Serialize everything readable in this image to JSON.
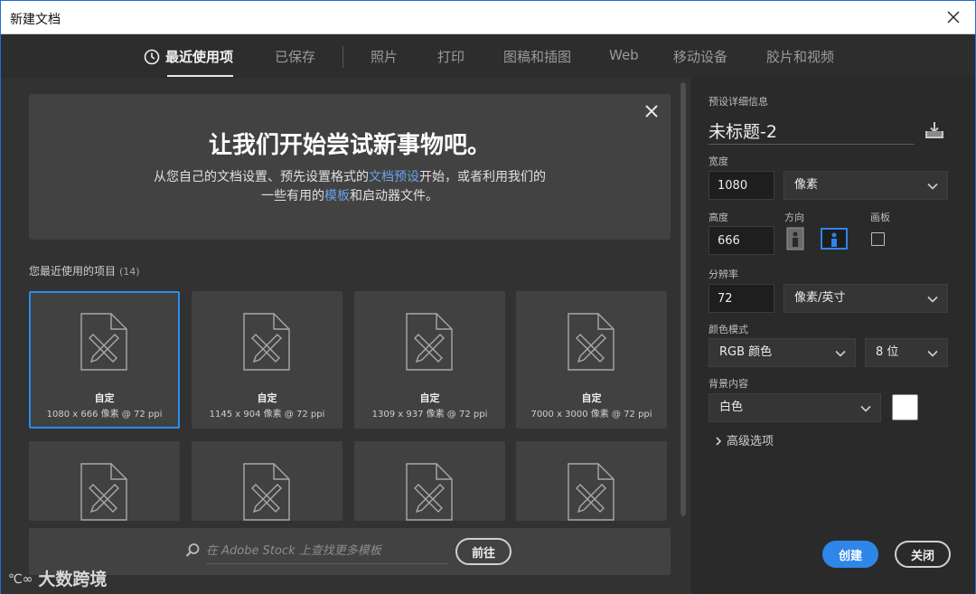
{
  "window": {
    "title": "新建文档"
  },
  "tabs": [
    {
      "label": "最近使用项",
      "active": true
    },
    {
      "label": "已保存"
    },
    {
      "label": "照片"
    },
    {
      "label": "打印"
    },
    {
      "label": "图稿和插图"
    },
    {
      "label": "Web"
    },
    {
      "label": "移动设备"
    },
    {
      "label": "胶片和视频"
    }
  ],
  "welcome": {
    "headline": "让我们开始尝试新事物吧。",
    "line1_pre": "从您自己的文档设置、预先设置格式的",
    "line1_link": "文档预设",
    "line1_post": "开始，或者利用我们的",
    "line2_pre": "一些有用的",
    "line2_link": "模板",
    "line2_post": "和启动器文件。"
  },
  "recent": {
    "label": "您最近使用的项目",
    "count": "(14)",
    "items": [
      {
        "name": "自定",
        "dims": "1080 x 666 像素 @ 72 ppi",
        "selected": true
      },
      {
        "name": "自定",
        "dims": "1145 x 904 像素 @ 72 ppi"
      },
      {
        "name": "自定",
        "dims": "1309 x 937 像素 @ 72 ppi"
      },
      {
        "name": "自定",
        "dims": "7000 x 3000 像素 @ 72 ppi"
      },
      {
        "name": "",
        "dims": ""
      },
      {
        "name": "",
        "dims": ""
      },
      {
        "name": "",
        "dims": ""
      },
      {
        "name": "",
        "dims": ""
      }
    ]
  },
  "stock": {
    "placeholder": "在 Adobe Stock 上查找更多模板",
    "go_label": "前往"
  },
  "preset": {
    "section_label": "预设详细信息",
    "name": "未标题-2",
    "width_label": "宽度",
    "width_value": "1080",
    "width_unit": "像素",
    "height_label": "高度",
    "height_value": "666",
    "orientation_label": "方向",
    "orientation": "landscape",
    "artboard_label": "画板",
    "artboard_checked": false,
    "resolution_label": "分辨率",
    "resolution_value": "72",
    "resolution_unit": "像素/英寸",
    "color_mode_label": "颜色模式",
    "color_mode": "RGB 颜色",
    "bit_depth": "8 位",
    "background_label": "背景内容",
    "background": "白色",
    "background_color": "#ffffff",
    "advanced_label": "高级选项"
  },
  "actions": {
    "create": "创建",
    "close": "关闭"
  },
  "watermark": {
    "logo": "℃∞",
    "text": "大数跨境"
  },
  "colors": {
    "accent": "#2e86e8",
    "link": "#6aa2ea",
    "selected_border": "#2a8cf0"
  }
}
